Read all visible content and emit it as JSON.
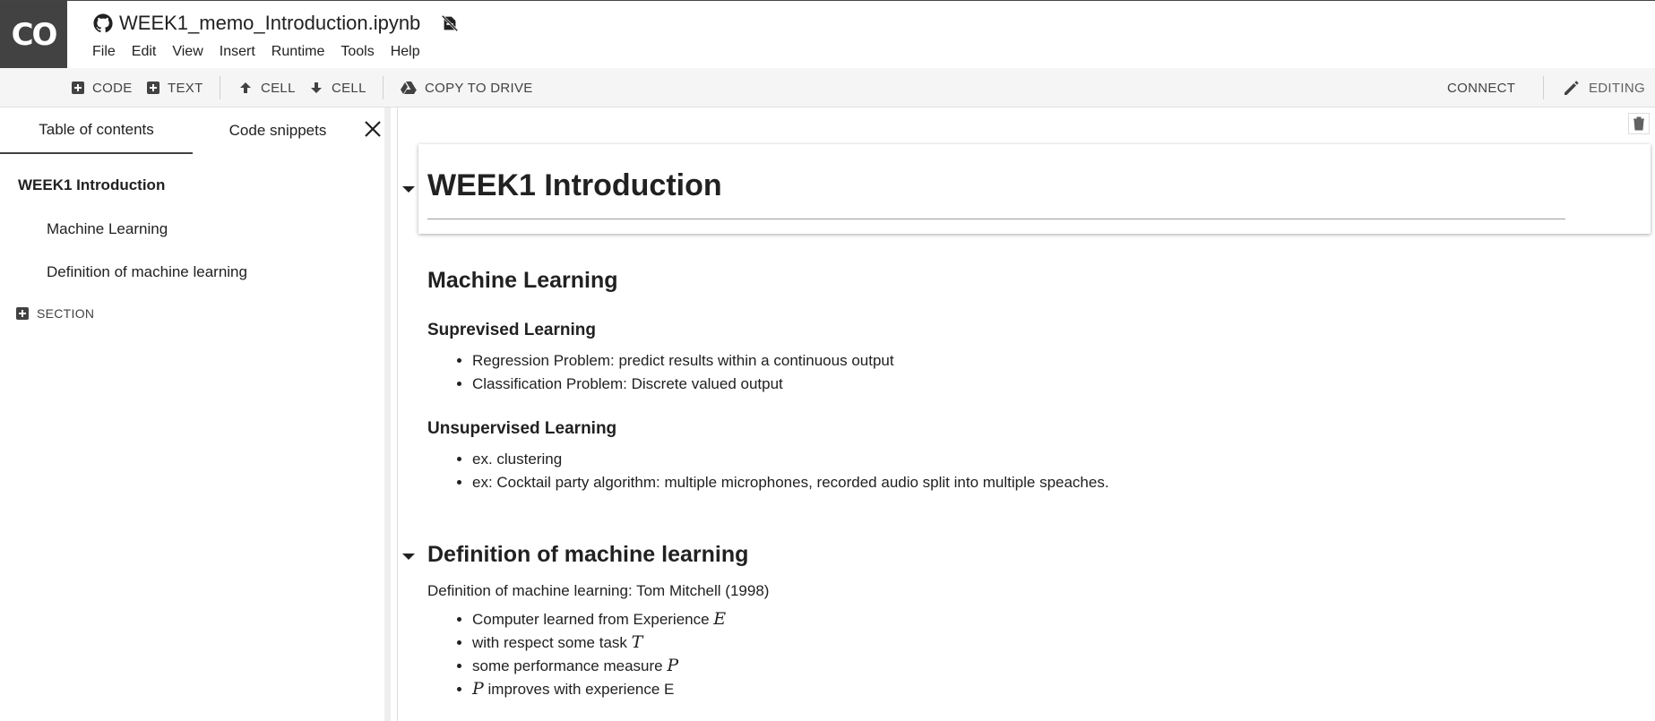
{
  "app": {
    "logo_text": "CO",
    "title": "WEEK1_memo_Introduction.ipynb"
  },
  "menu": [
    "File",
    "Edit",
    "View",
    "Insert",
    "Runtime",
    "Tools",
    "Help"
  ],
  "toolbar": {
    "code_label": "CODE",
    "text_label": "TEXT",
    "cell_up_label": "CELL",
    "cell_down_label": "CELL",
    "copy_label": "COPY TO DRIVE",
    "connect_label": "CONNECT",
    "editing_label": "EDITING"
  },
  "sidebar": {
    "tabs": [
      "Table of contents",
      "Code snippets"
    ],
    "toc": [
      "WEEK1 Introduction",
      "Machine Learning",
      "Definition of machine learning"
    ],
    "section_label": "SECTION"
  },
  "notebook": {
    "h1": "WEEK1 Introduction",
    "ml_heading": "Machine Learning",
    "supervised": {
      "heading": "Suprevised Learning",
      "items": [
        "Regression Problem: predict results within a continuous output",
        "Classification Problem: Discrete valued output"
      ]
    },
    "unsupervised": {
      "heading": "Unsupervised Learning",
      "items": [
        "ex. clustering",
        "ex: Cocktail party algorithm: multiple microphones, recorded audio split into multiple speaches."
      ]
    },
    "definition": {
      "heading": "Definition of machine learning",
      "intro": "Definition of machine learning: Tom Mitchell (1998)",
      "items": [
        {
          "pre": "Computer learned from Experience ",
          "var": "E",
          "post": ""
        },
        {
          "pre": "with respect some task ",
          "var": "T",
          "post": ""
        },
        {
          "pre": "some performance measure ",
          "var": "P",
          "post": ""
        },
        {
          "pre": "",
          "var": "P",
          "post": " improves with experience E"
        }
      ]
    }
  },
  "colors": {
    "logo_bg": "#424242",
    "toolbar_bg": "#f5f5f5",
    "text": "#212121"
  }
}
